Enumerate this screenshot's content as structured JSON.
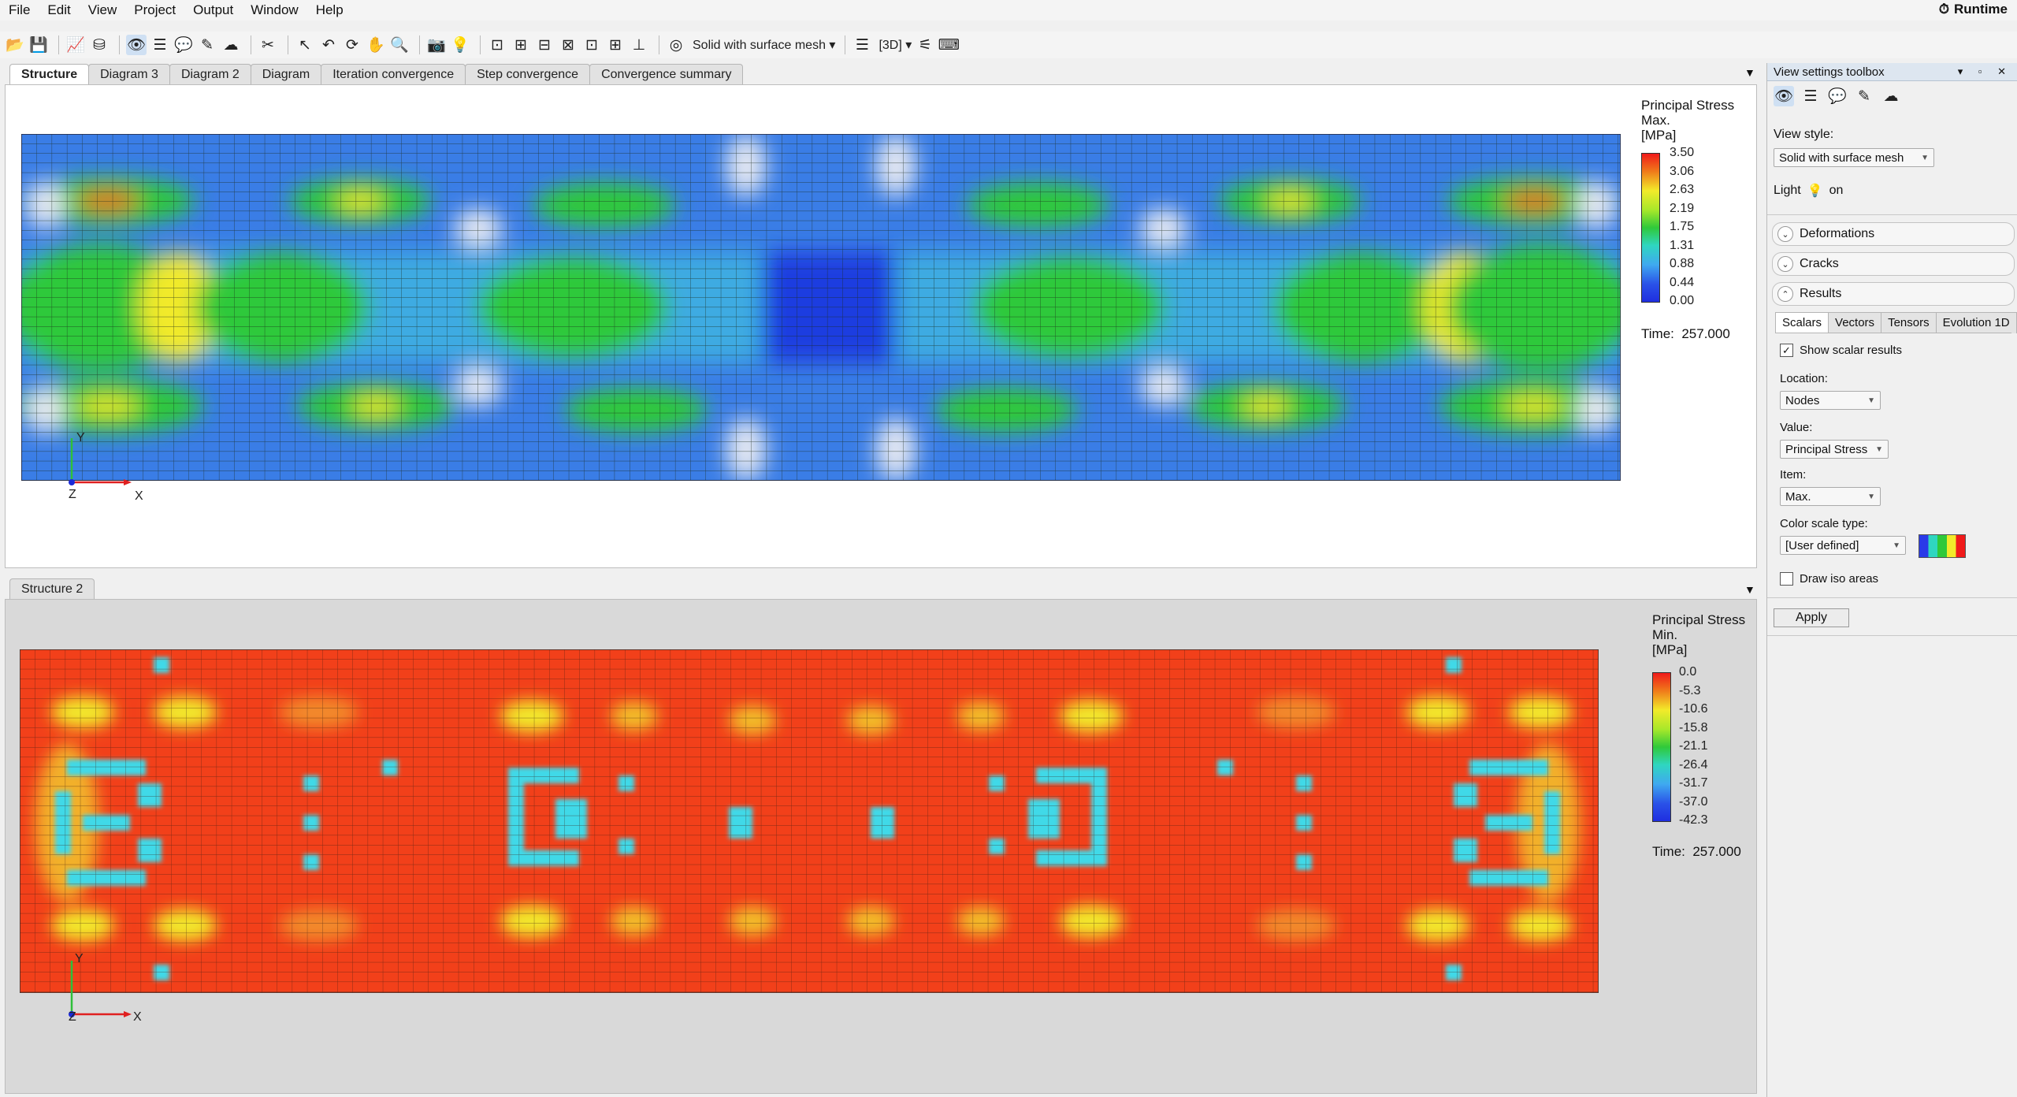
{
  "menu": [
    "File",
    "Edit",
    "View",
    "Project",
    "Output",
    "Window",
    "Help"
  ],
  "runtime_label": "Runtime",
  "toolbar": {
    "view_style_label": "Solid with surface mesh",
    "mode_label": "[3D]"
  },
  "top_tabs": [
    {
      "label": "Structure",
      "active": true
    },
    {
      "label": "Diagram 3"
    },
    {
      "label": "Diagram 2"
    },
    {
      "label": "Diagram"
    },
    {
      "label": "Iteration convergence"
    },
    {
      "label": "Step convergence"
    },
    {
      "label": "Convergence summary"
    }
  ],
  "bottom_tab": "Structure 2",
  "top_view": {
    "legend_title_1": "Principal Stress",
    "legend_title_2": "Max.",
    "legend_unit": "[MPa]",
    "ticks": [
      "3.50",
      "3.06",
      "2.63",
      "2.19",
      "1.75",
      "1.31",
      "0.88",
      "0.44",
      "0.00"
    ],
    "time_label": "Time:",
    "time_value": "257.000",
    "axis_x": "X",
    "axis_y": "Y",
    "axis_z": "Z"
  },
  "bottom_view": {
    "legend_title_1": "Principal Stress",
    "legend_title_2": "Min.",
    "legend_unit": "[MPa]",
    "ticks": [
      "0.0",
      "-5.3",
      "-10.6",
      "-15.8",
      "-21.1",
      "-26.4",
      "-31.7",
      "-37.0",
      "-42.3"
    ],
    "time_label": "Time:",
    "time_value": "257.000",
    "axis_x": "X",
    "axis_y": "Y",
    "axis_z": "Z"
  },
  "toolbox": {
    "title": "View settings toolbox",
    "view_style_label": "View style:",
    "view_style_value": "Solid with surface mesh",
    "light_label": "Light",
    "light_value": "on",
    "sections": [
      "Deformations",
      "Cracks",
      "Results"
    ],
    "subtabs": [
      "Scalars",
      "Vectors",
      "Tensors",
      "Evolution 1D"
    ],
    "show_scalar_label": "Show scalar results",
    "location_label": "Location:",
    "location_value": "Nodes",
    "value_label": "Value:",
    "value_value": "Principal Stress",
    "item_label": "Item:",
    "item_value": "Max.",
    "color_scale_label": "Color scale type:",
    "color_scale_value": "[User defined]",
    "draw_iso_label": "Draw iso areas",
    "apply_label": "Apply"
  },
  "colors": {
    "blue": "#2a52e8",
    "cyan": "#3fd9e8",
    "green": "#2fc93a",
    "yellow": "#f2ea2a",
    "red": "#f24a1a"
  }
}
